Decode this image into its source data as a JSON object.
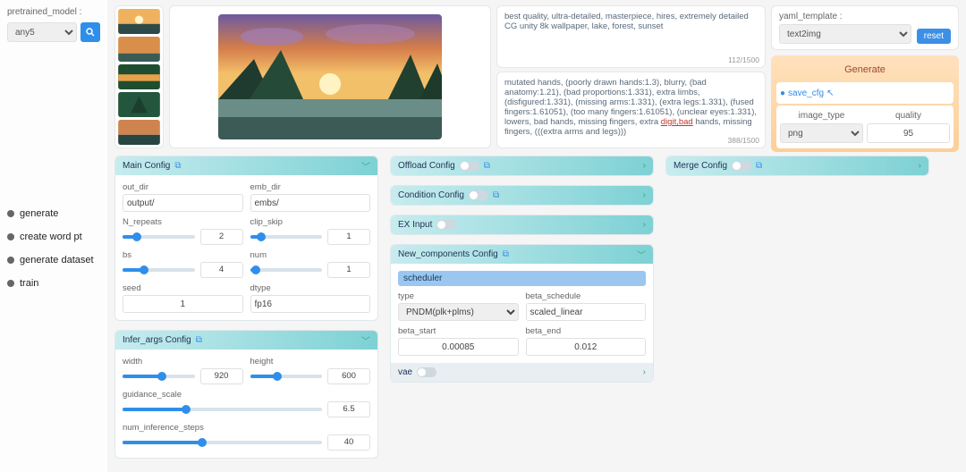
{
  "sidebar": {
    "model_label": "pretrained_model :",
    "model_value": "any5",
    "nav": [
      "generate",
      "create word pt",
      "generate dataset",
      "train"
    ]
  },
  "prompts": {
    "positive": "best quality, ultra-detailed, masterpiece, hires, extremely detailed CG unity 8k wallpaper, lake, forest, sunset",
    "positive_counter": "112/1500",
    "negative_pre": "mutated hands, (poorly drawn hands:1.3), blurry, (bad anatomy:1.21), (bad proportions:1.331), extra limbs, (disfigured:1.331), (missing arms:1.331), (extra legs:1.331), (fused fingers:1.61051), (too many fingers:1.61051), (unclear eyes:1.331), lowers, bad hands, missing fingers, extra ",
    "negative_bad": "digit,bad",
    "negative_post": " hands, missing fingers, (((extra arms and legs)))",
    "negative_counter": "388/1500"
  },
  "right": {
    "yaml_label": "yaml_template :",
    "yaml_value": "text2img",
    "reset": "reset",
    "generate": "Generate",
    "save_cfg": "save_cfg",
    "image_type_label": "image_type",
    "image_type_value": "png",
    "quality_label": "quality",
    "quality_value": "95"
  },
  "main_config": {
    "title": "Main Config",
    "out_dir_label": "out_dir",
    "out_dir": "output/",
    "emb_dir_label": "emb_dir",
    "emb_dir": "embs/",
    "n_repeats_label": "N_repeats",
    "n_repeats": "2",
    "clip_skip_label": "clip_skip",
    "clip_skip": "1",
    "bs_label": "bs",
    "bs": "4",
    "num_label": "num",
    "num": "1",
    "seed_label": "seed",
    "seed": "1",
    "dtype_label": "dtype",
    "dtype": "fp16"
  },
  "infer_args": {
    "title": "Infer_args Config",
    "width_label": "width",
    "width": "920",
    "height_label": "height",
    "height": "600",
    "gs_label": "guidance_scale",
    "gs": "6.5",
    "steps_label": "num_inference_steps",
    "steps": "40"
  },
  "closed_panels": {
    "offload": "Offload Config",
    "condition": "Condition Config",
    "ex": "EX Input",
    "merge": "Merge Config",
    "vae": "vae"
  },
  "new_comp": {
    "title": "New_components Config",
    "scheduler": "scheduler",
    "type_label": "type",
    "type_value": "PNDM(plk+plms)",
    "beta_schedule_label": "beta_schedule",
    "beta_schedule": "scaled_linear",
    "beta_start_label": "beta_start",
    "beta_start": "0.00085",
    "beta_end_label": "beta_end",
    "beta_end": "0.012"
  }
}
